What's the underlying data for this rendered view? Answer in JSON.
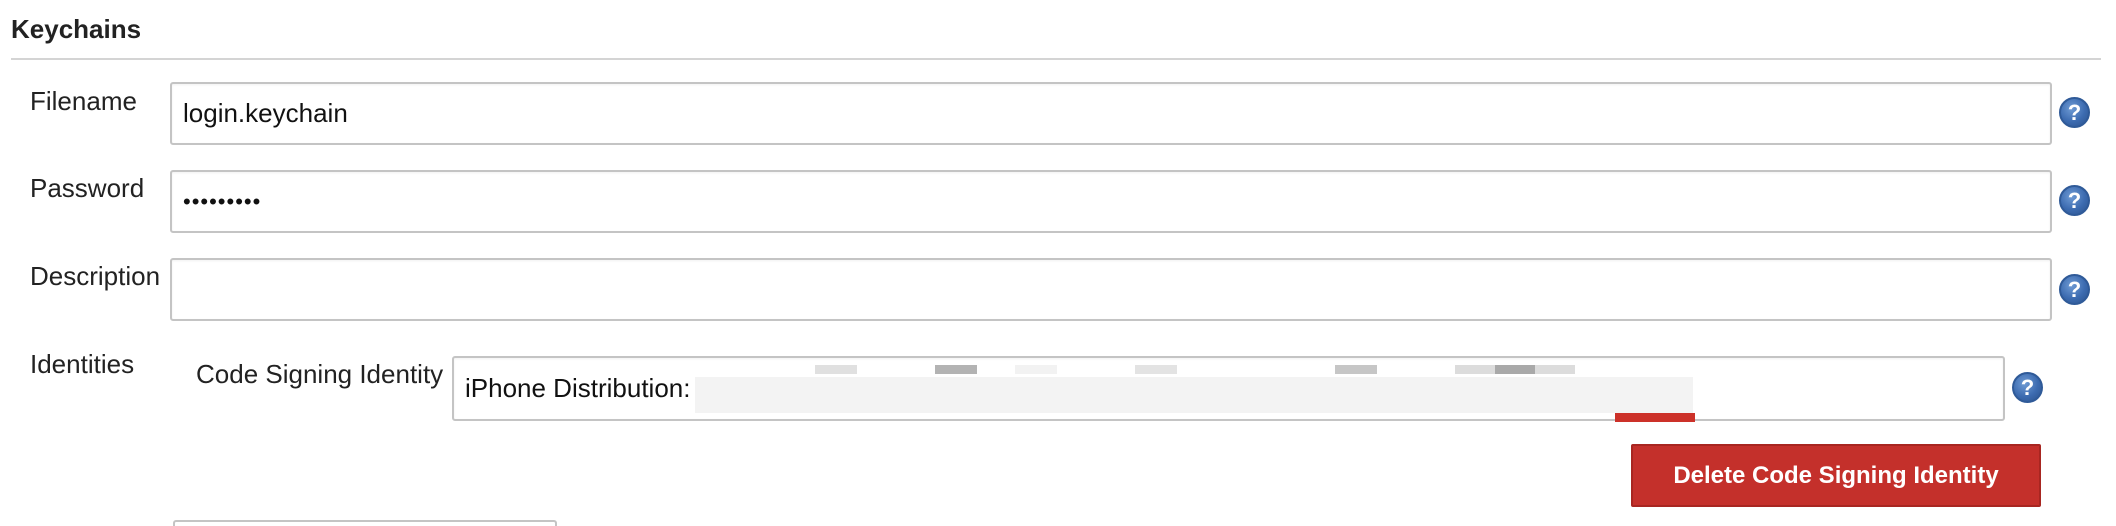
{
  "section": {
    "title": "Keychains"
  },
  "fields": {
    "filename": {
      "label": "Filename",
      "value": "login.keychain"
    },
    "password": {
      "label": "Password",
      "value": "•••••••••"
    },
    "description": {
      "label": "Description",
      "value": ""
    }
  },
  "identities": {
    "label": "Identities",
    "code_signing_identity": {
      "label": "Code Signing Identity",
      "value": "iPhone Distribution:"
    },
    "delete_button_label": "Delete Code Signing Identity"
  },
  "icons": {
    "help": "help-icon",
    "help_glyph": "?"
  },
  "colors": {
    "help_blue": "#3c6bb0",
    "delete_red": "#c4302b",
    "rule_gray": "#d4d4d4"
  }
}
